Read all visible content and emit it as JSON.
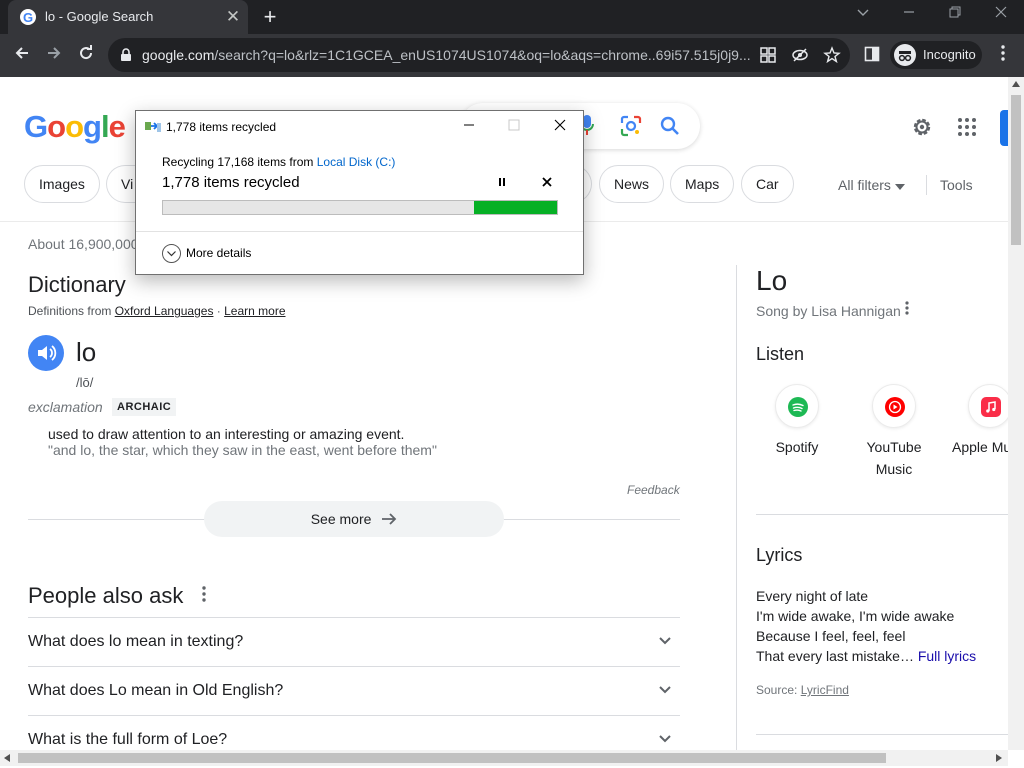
{
  "browser": {
    "tab_title": "lo - Google Search",
    "tab_close": "✕",
    "new_tab": "+",
    "url_host": "google.com",
    "url_path": "/search?q=lo&rlz=1C1GCEA_enUS1074US1074&oq=lo&aqs=chrome..69i57.515j0j9...",
    "profile_label": "Incognito"
  },
  "google": {
    "logo_letters": [
      "G",
      "o",
      "o",
      "g",
      "l",
      "e"
    ],
    "logo_colors": [
      "#4285f4",
      "#ea4335",
      "#fbbc05",
      "#4285f4",
      "#34a853",
      "#ea4335"
    ],
    "chips": [
      "Images",
      "Vi",
      "News",
      "Maps",
      "Car"
    ],
    "all_filters": "All filters",
    "tools": "Tools",
    "stats": "About 16,900,000"
  },
  "dictionary": {
    "title": "Dictionary",
    "source_prefix": "Definitions from ",
    "source_link": "Oxford Languages",
    "separator": " · ",
    "learn_more": "Learn more",
    "word": "lo",
    "phonetic": "/lō/",
    "part_of_speech": "exclamation",
    "register": "ARCHAIC",
    "definition": "used to draw attention to an interesting or amazing event.",
    "example": "\"and lo, the star, which they saw in the east, went before them\"",
    "feedback": "Feedback",
    "see_more": "See more"
  },
  "people_also_ask": {
    "title": "People also ask",
    "questions": [
      "What does lo mean in texting?",
      "What does Lo mean in Old English?",
      "What is the full form of Loe?"
    ]
  },
  "knowledge_panel": {
    "title": "Lo",
    "subtitle": "Song by Lisa Hannigan",
    "listen": "Listen",
    "services": [
      {
        "name": "Spotify",
        "color": "#1db954"
      },
      {
        "name": "YouTube Music",
        "color": "#ff0000"
      },
      {
        "name": "Apple Mu",
        "color": "#fa2d48"
      }
    ],
    "lyrics_title": "Lyrics",
    "lyrics": [
      "Every night of late",
      "I'm wide awake, I'm wide awake",
      "Because I feel, feel, feel",
      "That every last mistake…"
    ],
    "full_lyrics": "Full lyrics",
    "lyrics_source_prefix": "Source: ",
    "lyrics_source_link": "LyricFind"
  },
  "dialog": {
    "title": "1,778 items recycled",
    "from_prefix": "Recycling 17,168 items from ",
    "from_location": "Local Disk (C:)",
    "status": "1,778 items recycled",
    "progress": 0.21,
    "more_details": "More details",
    "progress_color": "#06b025"
  }
}
